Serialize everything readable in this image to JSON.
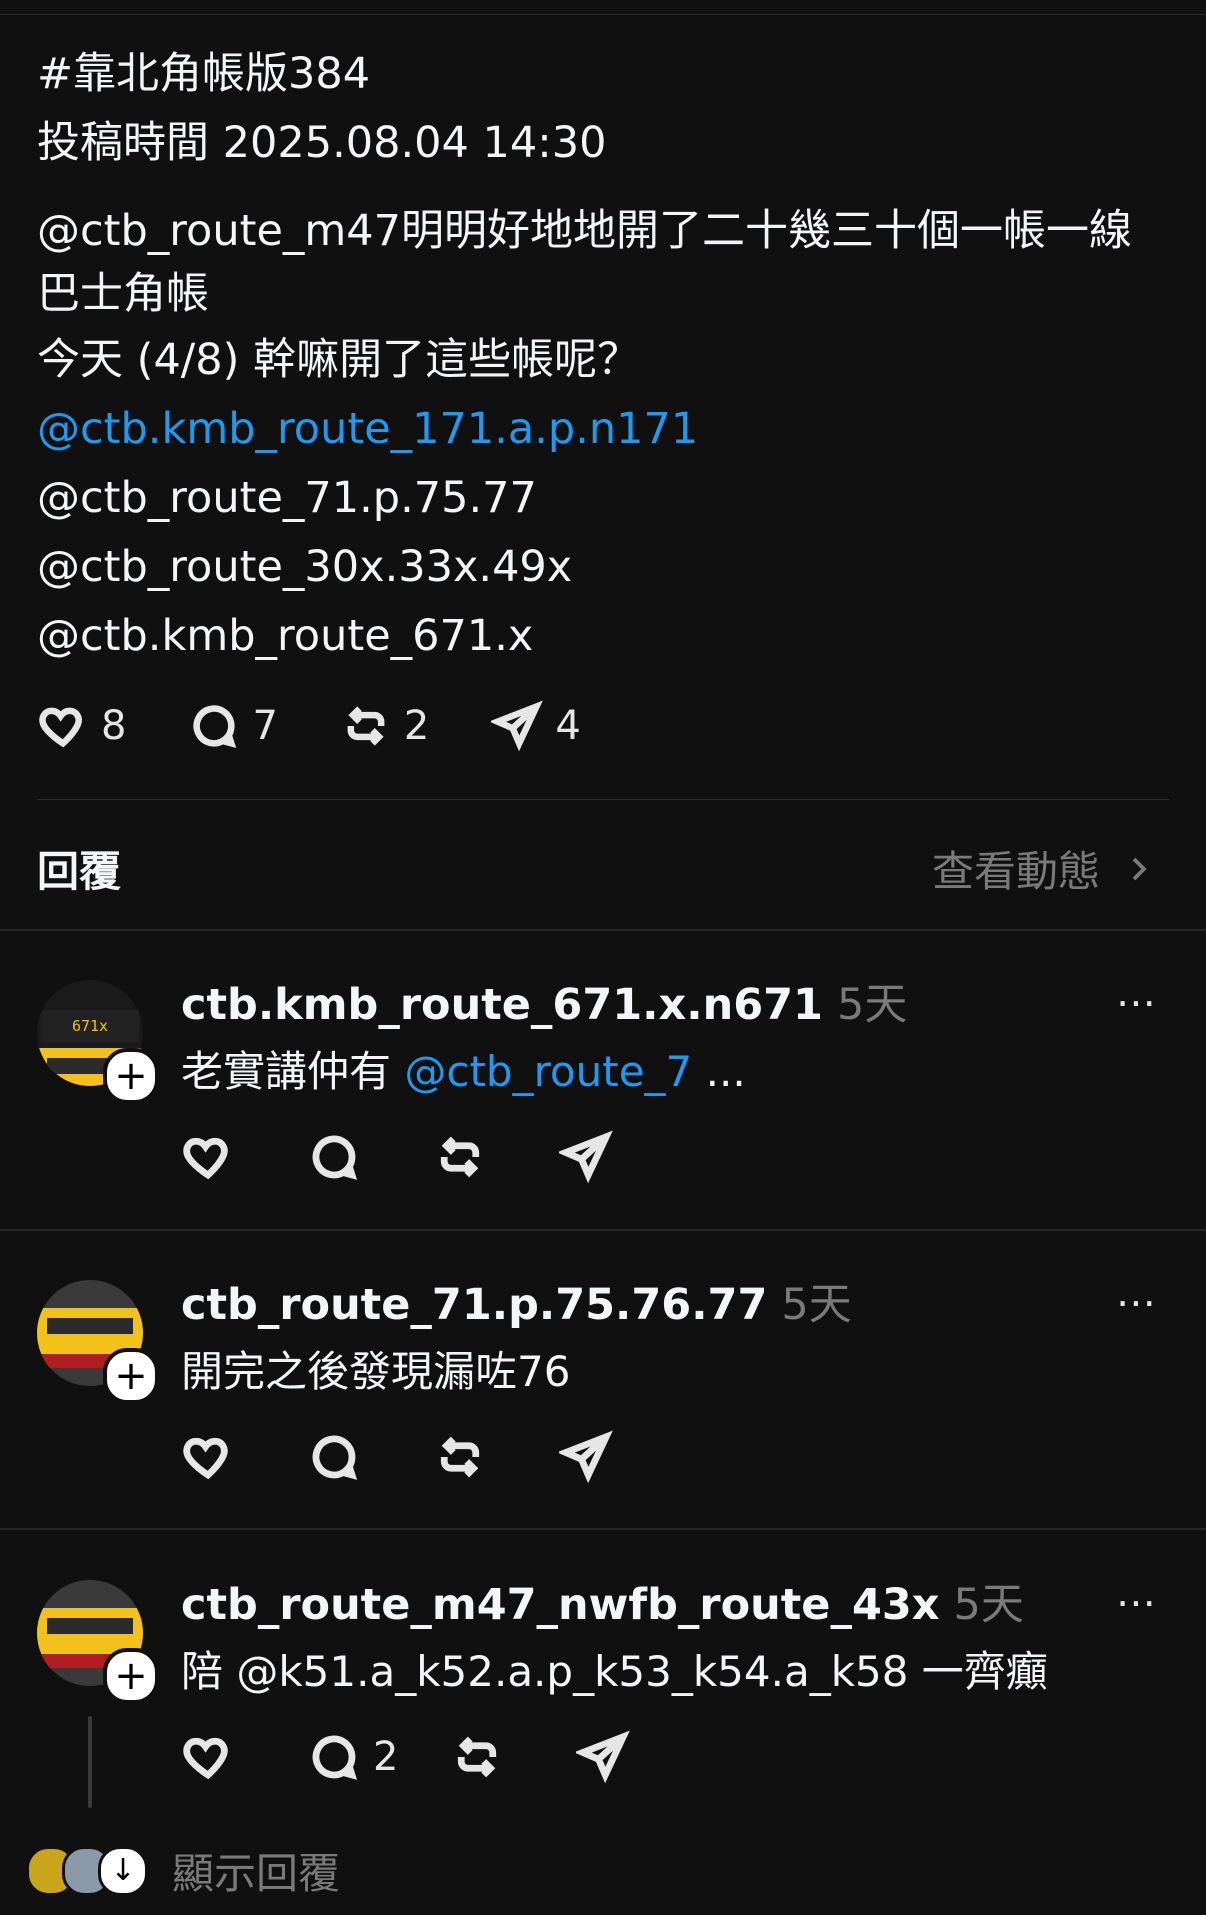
{
  "post": {
    "line1": "#靠北角帳版384",
    "line2": "投稿時間 2025.08.04 14:30",
    "line3": "@ctb_route_m47明明好地地開了二十幾三十個一帳一線巴士角帳",
    "line4": "今天 (4/8) 幹嘛開了這些帳呢？",
    "mention1": "@ctb.kmb_route_171.a.p.n171",
    "mention2": "@ctb_route_71.p.75.77",
    "mention3": "@ctb_route_30x.33x.49x",
    "mention4": "@ctb.kmb_route_671.x"
  },
  "post_actions": {
    "likes": "8",
    "comments": "7",
    "reposts": "2",
    "shares": "4"
  },
  "replies_header": {
    "title": "回覆",
    "view_activity": "查看動態"
  },
  "replies": [
    {
      "username": "ctb.kmb_route_671.x.n671",
      "time": "5天",
      "text_plain": "老實講仲有 ",
      "text_mention": "@ctb_route_7",
      "text_tail": " ...",
      "avatar_sign": "671x",
      "comments": ""
    },
    {
      "username": "ctb_route_71.p.75.76.77",
      "time": "5天",
      "text_plain": "開完之後發現漏咗76",
      "text_mention": "",
      "text_tail": "",
      "comments": ""
    },
    {
      "username": "ctb_route_m47_nwfb_route_43x",
      "time": "5天",
      "text_plain": "陪 @k51.a_k52.a.p_k53_k54.a_k58 一齊癲",
      "text_mention": "",
      "text_tail": "",
      "comments": "2"
    }
  ],
  "show_replies": "顯示回覆",
  "more_icon": "⋯",
  "colors": {
    "background": "#101010",
    "mention": "#1d9bf0",
    "muted": "#7a7a7a"
  }
}
